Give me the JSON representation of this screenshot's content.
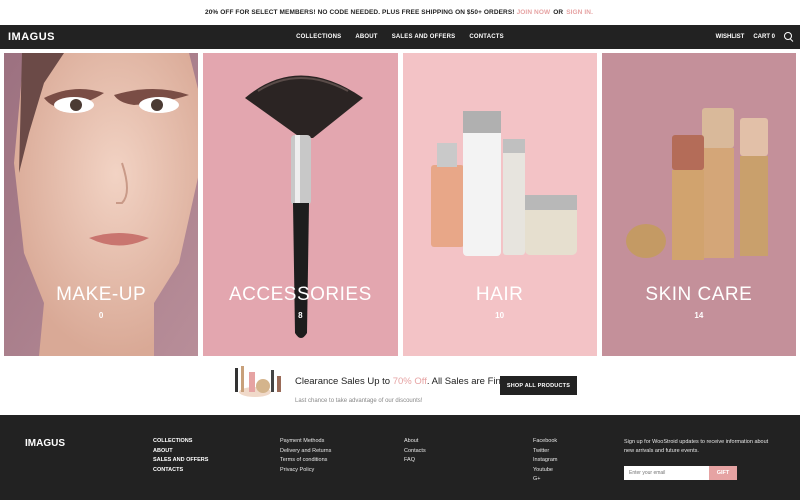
{
  "promo": {
    "text_before": "20% OFF FOR SELECT MEMBERS! NO CODE NEEDED. PLUS FREE SHIPPING ON $50+ ORDERS!",
    "join_link": "JOIN NOW",
    "or_text": "OR",
    "signin_link": "SIGN IN."
  },
  "header": {
    "logo": "IMAGUS",
    "nav": [
      "COLLECTIONS",
      "ABOUT",
      "SALES AND OFFERS",
      "CONTACTS"
    ],
    "wishlist": "WISHLIST",
    "cart": "CART 0"
  },
  "tiles": [
    {
      "name": "MAKE-UP",
      "count": "0"
    },
    {
      "name": "ACCESSORIES",
      "count": "8"
    },
    {
      "name": "HAIR",
      "count": "10"
    },
    {
      "name": "SKIN CARE",
      "count": "14"
    }
  ],
  "clearance": {
    "title_before": "Clearance Sales Up to ",
    "percent": "70% Off",
    "title_after": ". All Sales are Final!",
    "subtitle": "Last chance to take advantage of our discounts!",
    "button": "SHOP ALL PRODUCTS"
  },
  "footer": {
    "logo": "IMAGUS",
    "col1": [
      "COLLECTIONS",
      "ABOUT",
      "SALES AND OFFERS",
      "CONTACTS"
    ],
    "col2": [
      "Payment Methods",
      "Delivery and Returns",
      "Terms of conditions",
      "Privacy Policy"
    ],
    "col3": [
      "About",
      "Contacts",
      "FAQ"
    ],
    "col4": [
      "Facebook",
      "Twitter",
      "Instagram",
      "Youtube",
      "G+"
    ],
    "newsletter": "Sign up for WooStroid updates to receive information about new arrivals and future events.",
    "email_placeholder": "Enter your email",
    "gift_button": "GIFT"
  },
  "colors": {
    "dark": "#222222",
    "accent_pink": "#e6a3a3",
    "tile_makeup_bg": "#a57d89",
    "tile_accessories_bg": "#e3a6af",
    "tile_hair_bg": "#f3c3c6",
    "tile_skincare_bg": "#c4909a"
  }
}
